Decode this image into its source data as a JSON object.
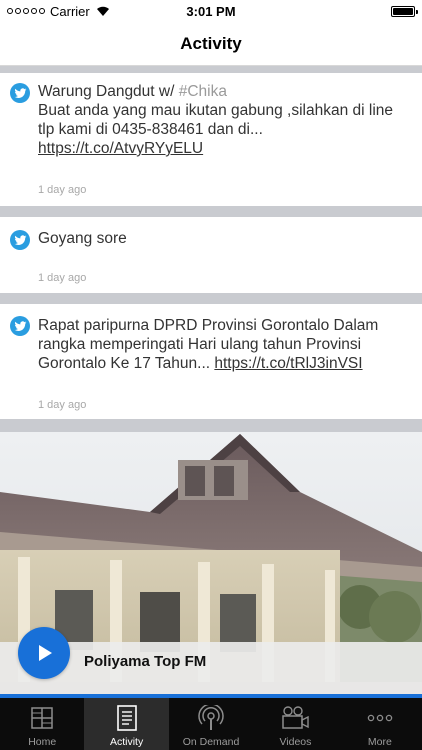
{
  "status_bar": {
    "carrier": "Carrier",
    "time": "3:01 PM"
  },
  "nav": {
    "title": "Activity"
  },
  "feed": [
    {
      "icon": "twitter-icon",
      "title_prefix": "Warung Dangdut w/ ",
      "hashtag": "#Chika",
      "body": "Buat anda yang mau ikutan gabung ,silahkan di line tlp kami di 0435-838461 dan di... ",
      "link": "https://t.co/AtvyRYyELU",
      "time": "1 day ago"
    },
    {
      "icon": "twitter-icon",
      "title_prefix": "Goyang sore",
      "time": "1 day ago"
    },
    {
      "icon": "twitter-icon",
      "body": "Rapat paripurna DPRD Provinsi Gorontalo Dalam rangka memperingati Hari ulang tahun Provinsi Gorontalo Ke 17 Tahun... ",
      "link": "https://t.co/tRlJ3inVSI",
      "time": "1 day ago"
    }
  ],
  "player": {
    "station": "Poliyama Top FM",
    "accent": "#1870d8"
  },
  "tabs": [
    {
      "label": "Home",
      "icon": "home-grid-icon",
      "active": false
    },
    {
      "label": "Activity",
      "icon": "activity-doc-icon",
      "active": true
    },
    {
      "label": "On Demand",
      "icon": "podcast-icon",
      "active": false
    },
    {
      "label": "Videos",
      "icon": "video-camera-icon",
      "active": false
    },
    {
      "label": "More",
      "icon": "more-dots-icon",
      "active": false
    }
  ]
}
